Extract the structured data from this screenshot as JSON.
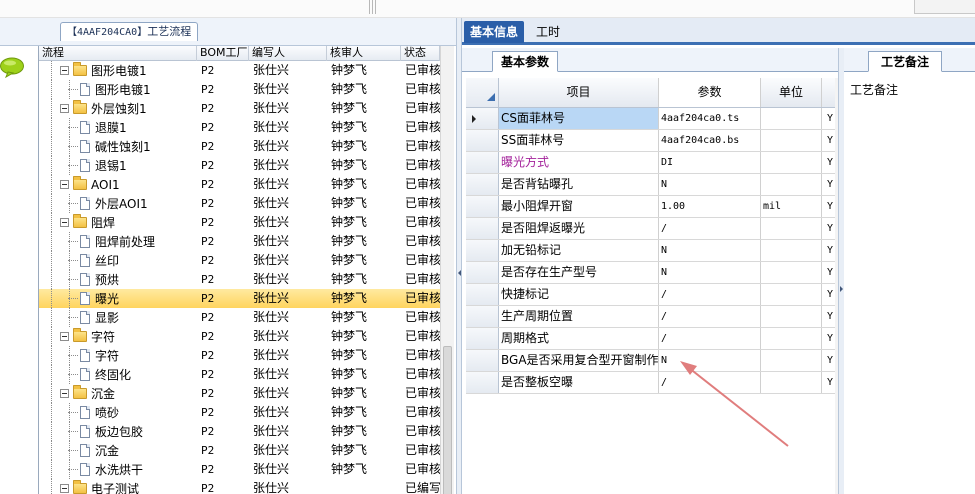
{
  "flow_tab": {
    "code": "【4AAF204CA0】",
    "label": "工艺流程"
  },
  "tree": {
    "columns": [
      "流程",
      "BOM工厂",
      "编写人",
      "核审人",
      "状态"
    ],
    "rows": [
      {
        "name": "图形电镀1",
        "level": 1,
        "folder": true,
        "bom": "P2",
        "author": "张仕兴",
        "reviewer": "钟梦飞",
        "status": "已审核"
      },
      {
        "name": "图形电镀1",
        "level": 2,
        "folder": false,
        "bom": "P2",
        "author": "张仕兴",
        "reviewer": "钟梦飞",
        "status": "已审核"
      },
      {
        "name": "外层蚀刻1",
        "level": 1,
        "folder": true,
        "bom": "P2",
        "author": "张仕兴",
        "reviewer": "钟梦飞",
        "status": "已审核"
      },
      {
        "name": "退膜1",
        "level": 2,
        "folder": false,
        "bom": "P2",
        "author": "张仕兴",
        "reviewer": "钟梦飞",
        "status": "已审核"
      },
      {
        "name": "碱性蚀刻1",
        "level": 2,
        "folder": false,
        "bom": "P2",
        "author": "张仕兴",
        "reviewer": "钟梦飞",
        "status": "已审核"
      },
      {
        "name": "退锡1",
        "level": 2,
        "folder": false,
        "bom": "P2",
        "author": "张仕兴",
        "reviewer": "钟梦飞",
        "status": "已审核"
      },
      {
        "name": "AOI1",
        "level": 1,
        "folder": true,
        "bom": "P2",
        "author": "张仕兴",
        "reviewer": "钟梦飞",
        "status": "已审核"
      },
      {
        "name": "外层AOI1",
        "level": 2,
        "folder": false,
        "bom": "P2",
        "author": "张仕兴",
        "reviewer": "钟梦飞",
        "status": "已审核"
      },
      {
        "name": "阻焊",
        "level": 1,
        "folder": true,
        "bom": "P2",
        "author": "张仕兴",
        "reviewer": "钟梦飞",
        "status": "已审核"
      },
      {
        "name": "阻焊前处理",
        "level": 2,
        "folder": false,
        "bom": "P2",
        "author": "张仕兴",
        "reviewer": "钟梦飞",
        "status": "已审核"
      },
      {
        "name": "丝印",
        "level": 2,
        "folder": false,
        "bom": "P2",
        "author": "张仕兴",
        "reviewer": "钟梦飞",
        "status": "已审核"
      },
      {
        "name": "预烘",
        "level": 2,
        "folder": false,
        "bom": "P2",
        "author": "张仕兴",
        "reviewer": "钟梦飞",
        "status": "已审核"
      },
      {
        "name": "曝光",
        "level": 2,
        "folder": false,
        "bom": "P2",
        "author": "张仕兴",
        "reviewer": "钟梦飞",
        "status": "已审核",
        "selected": true
      },
      {
        "name": "显影",
        "level": 2,
        "folder": false,
        "bom": "P2",
        "author": "张仕兴",
        "reviewer": "钟梦飞",
        "status": "已审核"
      },
      {
        "name": "字符",
        "level": 1,
        "folder": true,
        "bom": "P2",
        "author": "张仕兴",
        "reviewer": "钟梦飞",
        "status": "已审核"
      },
      {
        "name": "字符",
        "level": 2,
        "folder": false,
        "bom": "P2",
        "author": "张仕兴",
        "reviewer": "钟梦飞",
        "status": "已审核"
      },
      {
        "name": "终固化",
        "level": 2,
        "folder": false,
        "bom": "P2",
        "author": "张仕兴",
        "reviewer": "钟梦飞",
        "status": "已审核"
      },
      {
        "name": "沉金",
        "level": 1,
        "folder": true,
        "bom": "P2",
        "author": "张仕兴",
        "reviewer": "钟梦飞",
        "status": "已审核"
      },
      {
        "name": "喷砂",
        "level": 2,
        "folder": false,
        "bom": "P2",
        "author": "张仕兴",
        "reviewer": "钟梦飞",
        "status": "已审核"
      },
      {
        "name": "板边包胶",
        "level": 2,
        "folder": false,
        "bom": "P2",
        "author": "张仕兴",
        "reviewer": "钟梦飞",
        "status": "已审核"
      },
      {
        "name": "沉金",
        "level": 2,
        "folder": false,
        "bom": "P2",
        "author": "张仕兴",
        "reviewer": "钟梦飞",
        "status": "已审核"
      },
      {
        "name": "水洗烘干",
        "level": 2,
        "folder": false,
        "bom": "P2",
        "author": "张仕兴",
        "reviewer": "钟梦飞",
        "status": "已审核"
      },
      {
        "name": "电子测试",
        "level": 1,
        "folder": true,
        "bom": "P2",
        "author": "张仕兴",
        "reviewer": "",
        "status": "已编写"
      }
    ]
  },
  "right_tabs": {
    "basic_info": "基本信息",
    "work_hours": "工时"
  },
  "param_panel": {
    "tab_label": "基本参数",
    "columns": {
      "item": "项目",
      "param": "参数",
      "unit": "单位"
    },
    "rows": [
      {
        "item": "CS面菲林号",
        "param": "4aaf204ca0.ts",
        "unit": "",
        "flag": "Y",
        "current": true
      },
      {
        "item": "SS面菲林号",
        "param": "4aaf204ca0.bs",
        "unit": "",
        "flag": "Y"
      },
      {
        "item": "曝光方式",
        "param": "DI",
        "unit": "",
        "flag": "Y",
        "highlight": true
      },
      {
        "item": "是否背钻曝孔",
        "param": "N",
        "unit": "",
        "flag": "Y"
      },
      {
        "item": "最小阻焊开窗",
        "param": "1.00",
        "unit": "mil",
        "flag": "Y"
      },
      {
        "item": "是否阻焊返曝光",
        "param": "/",
        "unit": "",
        "flag": "Y"
      },
      {
        "item": "加无铅标记",
        "param": "N",
        "unit": "",
        "flag": "Y"
      },
      {
        "item": "是否存在生产型号",
        "param": "N",
        "unit": "",
        "flag": "Y"
      },
      {
        "item": "快捷标记",
        "param": "/",
        "unit": "",
        "flag": "Y"
      },
      {
        "item": "生产周期位置",
        "param": "/",
        "unit": "",
        "flag": "Y"
      },
      {
        "item": "周期格式",
        "param": "/",
        "unit": "",
        "flag": "Y"
      },
      {
        "item": "BGA是否采用复合型开窗制作",
        "param": "N",
        "unit": "",
        "flag": "Y"
      },
      {
        "item": "是否整板空曝",
        "param": "/",
        "unit": "",
        "flag": "Y"
      }
    ]
  },
  "remark_panel": {
    "tab_label": "工艺备注",
    "label": "工艺备注"
  },
  "colors": {
    "tab_active": "#2a5ea8",
    "selection": "#ffd45e",
    "current_cell": "#b9d7f5",
    "highlight_text": "#a3219a",
    "annotation_arrow": "#e07d7d"
  },
  "icons": {
    "chat": "speech-bubble-icon",
    "folder": "folder-icon",
    "document": "document-icon",
    "expander": "tree-collapse-icon"
  }
}
